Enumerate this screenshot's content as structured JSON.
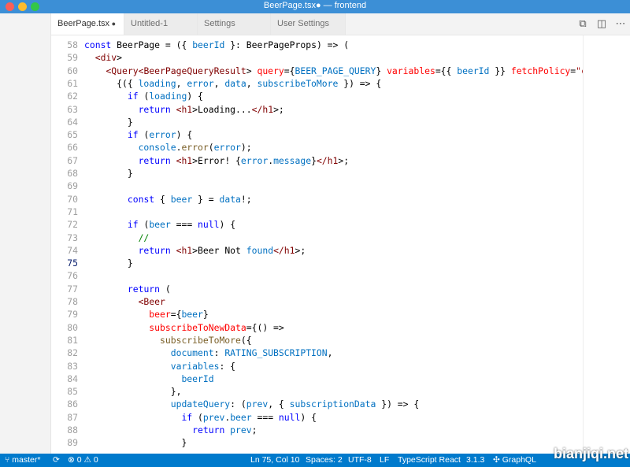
{
  "window": {
    "title": "BeerPage.tsx● — frontend"
  },
  "tabs": [
    {
      "label": "BeerPage.tsx",
      "dirty": "●"
    },
    {
      "label": "Untitled-1"
    },
    {
      "label": "Settings"
    },
    {
      "label": "User Settings"
    }
  ],
  "tab_actions": [
    "compare-icon",
    "split-editor-icon",
    "more-icon"
  ],
  "editor": {
    "current_line": "75",
    "lines": [
      {
        "n": "58",
        "code": "const BeerPage = ({ beerId }: BeerPageProps) => ("
      },
      {
        "n": "59",
        "code": "  <div>"
      },
      {
        "n": "60",
        "code": "    <Query<BeerPageQueryResult> query={BEER_PAGE_QUERY} variables={{ beerId }} fetchPolicy=\"cache"
      },
      {
        "n": "61",
        "code": "      {({ loading, error, data, subscribeToMore }) => {"
      },
      {
        "n": "62",
        "code": "        if (loading) {"
      },
      {
        "n": "63",
        "code": "          return <h1>Loading...</h1>;"
      },
      {
        "n": "64",
        "code": "        }"
      },
      {
        "n": "65",
        "code": "        if (error) {"
      },
      {
        "n": "66",
        "code": "          console.error(error);"
      },
      {
        "n": "67",
        "code": "          return <h1>Error! {error.message}</h1>;"
      },
      {
        "n": "68",
        "code": "        }"
      },
      {
        "n": "69",
        "code": ""
      },
      {
        "n": "70",
        "code": "        const { beer } = data!;"
      },
      {
        "n": "71",
        "code": ""
      },
      {
        "n": "72",
        "code": "        if (beer === null) {"
      },
      {
        "n": "73",
        "code": "          //"
      },
      {
        "n": "74",
        "code": "          return <h1>Beer Not found</h1>;"
      },
      {
        "n": "75",
        "code": "        }"
      },
      {
        "n": "76",
        "code": ""
      },
      {
        "n": "77",
        "code": "        return ("
      },
      {
        "n": "78",
        "code": "          <Beer"
      },
      {
        "n": "79",
        "code": "            beer={beer}"
      },
      {
        "n": "80",
        "code": "            subscribeToNewData={() =>"
      },
      {
        "n": "81",
        "code": "              subscribeToMore({"
      },
      {
        "n": "82",
        "code": "                document: RATING_SUBSCRIPTION,"
      },
      {
        "n": "83",
        "code": "                variables: {"
      },
      {
        "n": "84",
        "code": "                  beerId"
      },
      {
        "n": "85",
        "code": "                },"
      },
      {
        "n": "86",
        "code": "                updateQuery: (prev, { subscriptionData }) => {"
      },
      {
        "n": "87",
        "code": "                  if (prev.beer === null) {"
      },
      {
        "n": "88",
        "code": "                    return prev;"
      },
      {
        "n": "89",
        "code": "                  }"
      }
    ]
  },
  "statusbar": {
    "branch": "master*",
    "sync_icon": "sync-icon",
    "errors": "0",
    "warnings": "0",
    "position": "Ln 75, Col 10",
    "spaces": "Spaces: 2",
    "encoding": "UTF-8",
    "eol": "LF",
    "language": "TypeScript React",
    "version": "3.1.3",
    "graphql": "GraphQL"
  },
  "watermark": "bianjiqi.net",
  "colors": {
    "accent": "#007acc",
    "titlebar": "#3c8fd6"
  }
}
